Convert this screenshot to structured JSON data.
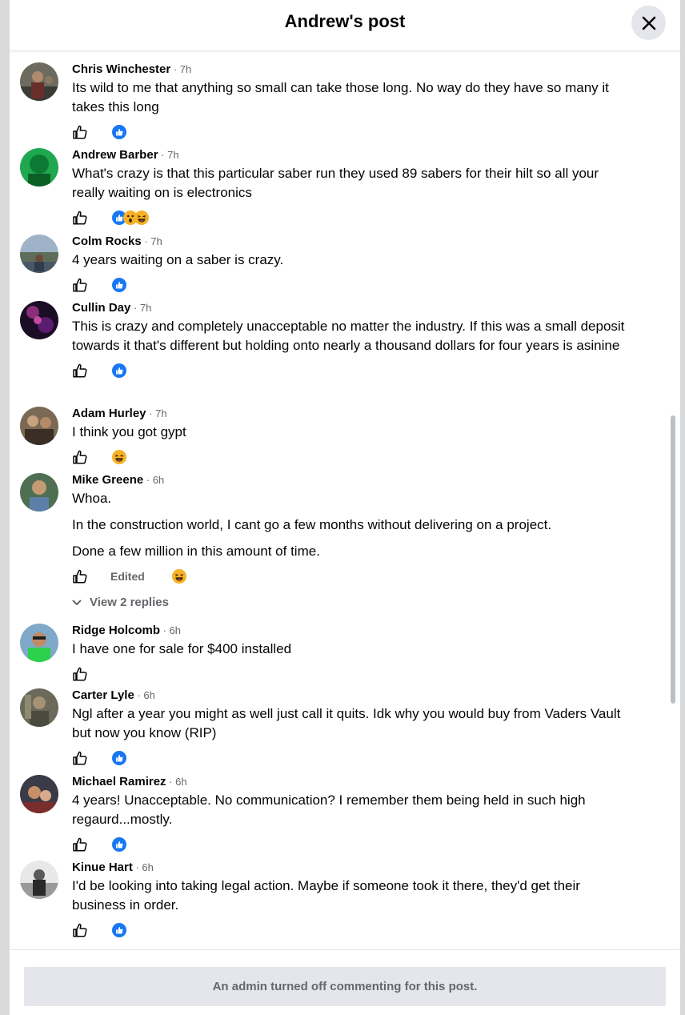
{
  "modal": {
    "title": "Andrew's post"
  },
  "comments": [
    {
      "author": "Chris Winchester",
      "time": "7h",
      "text": [
        "Its wild to me that anything so small can take those long. No way do they have so many it takes this long"
      ],
      "reactions": [
        "like"
      ]
    },
    {
      "author": "Andrew Barber",
      "time": "7h",
      "text": [
        "What's crazy is that this particular saber run they used 89 sabers for their hilt so all your really waiting on is electronics"
      ],
      "reactions": [
        "like",
        "wow",
        "haha"
      ]
    },
    {
      "author": "Colm Rocks",
      "time": "7h",
      "text": [
        "4 years waiting on a saber is crazy."
      ],
      "reactions": [
        "like"
      ]
    },
    {
      "author": "Cullin Day",
      "time": "7h",
      "text": [
        "This is crazy and completely unacceptable no matter the industry. If this was a small deposit towards it that's different but holding onto nearly a thousand dollars for four years is asinine"
      ],
      "reactions": [
        "like"
      ]
    },
    {
      "author": "Adam Hurley",
      "time": "7h",
      "text": [
        "I think you got gypt"
      ],
      "reactions": [
        "haha"
      ]
    },
    {
      "author": "Mike Greene",
      "time": "6h",
      "text": [
        "Whoa.",
        "In the construction world, I cant go a few months without delivering on a project.",
        "Done a few million in this amount of time."
      ],
      "edited": "Edited",
      "reactions": [
        "haha"
      ],
      "view_replies": "View 2 replies"
    },
    {
      "author": "Ridge Holcomb",
      "time": "6h",
      "text": [
        "I have one for sale for $400 installed"
      ],
      "reactions": []
    },
    {
      "author": "Carter Lyle",
      "time": "6h",
      "text": [
        "Ngl after a year you might as well just call it quits. Idk why you would buy from Vaders Vault but now you know (RIP)"
      ],
      "reactions": [
        "like"
      ]
    },
    {
      "author": "Michael Ramirez",
      "time": "6h",
      "text": [
        "4 years! Unacceptable. No communication? I remember them being held in such high regaurd...mostly."
      ],
      "reactions": [
        "like"
      ]
    },
    {
      "author": "Kinue Hart",
      "time": "6h",
      "text": [
        "I'd be looking into taking legal action. Maybe if someone took it there, they'd get their business in order."
      ],
      "reactions": [
        "like"
      ]
    }
  ],
  "footer": {
    "notice": "An admin turned off commenting for this post."
  },
  "colors": {
    "like_blue": "#1877f2",
    "secondary_text": "#65676b",
    "haha_yellow": "#f7b125"
  }
}
